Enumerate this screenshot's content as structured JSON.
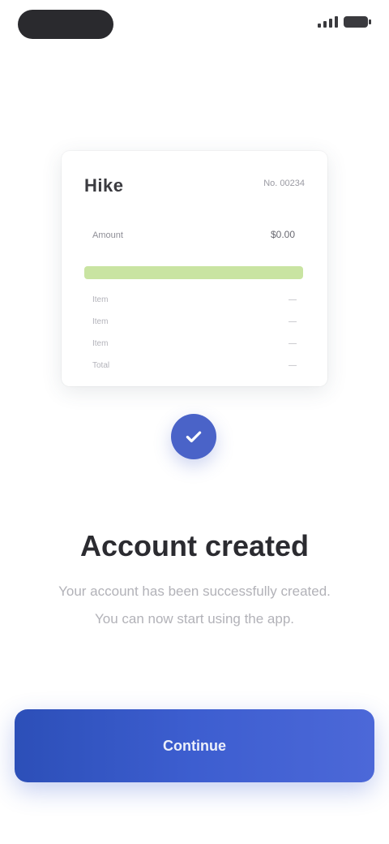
{
  "status_bar": {
    "signal_icon": "signal-icon",
    "battery_icon": "battery-icon"
  },
  "receipt": {
    "logo": "Hike",
    "meta": "No. 00234",
    "row1_label": "Amount",
    "row1_value": "$0.00",
    "highlight_color": "#c9e4a2",
    "lines": [
      {
        "label": "Item",
        "value": "—"
      },
      {
        "label": "Item",
        "value": "—"
      },
      {
        "label": "Item",
        "value": "—"
      },
      {
        "label": "Total",
        "value": "—"
      }
    ]
  },
  "badge": {
    "icon": "check-icon",
    "color": "#4a63c8"
  },
  "headline": "Account created",
  "subtext": "Your account has been successfully created. You can now start using the app.",
  "cta": {
    "label": "Continue",
    "color": "#3d5ed0"
  }
}
